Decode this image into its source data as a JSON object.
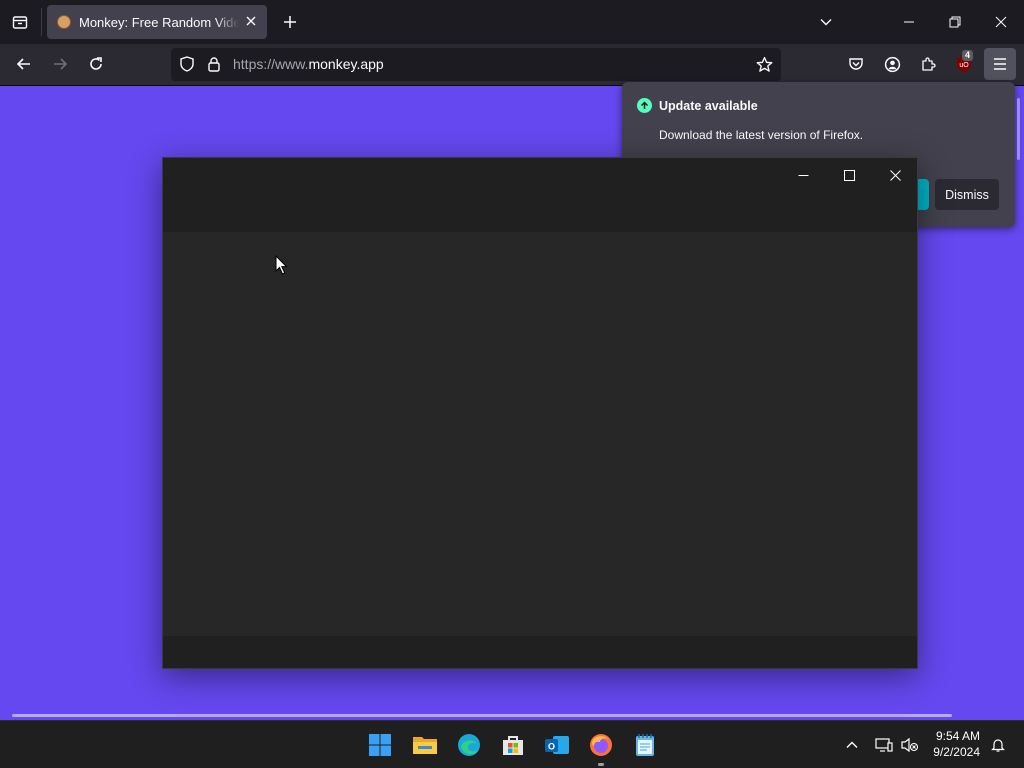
{
  "browser": {
    "tab_title": "Monkey: Free Random Video Chat",
    "url_prefix": "https://www.",
    "url_domain": "monkey.app",
    "extension_badge": "4",
    "icons": [
      "tab-list-icon",
      "close-icon",
      "new-tab-icon",
      "chevron-down-icon",
      "minimize-icon",
      "restore-icon",
      "back-icon",
      "forward-icon",
      "reload-icon",
      "shield-icon",
      "lock-icon",
      "star-icon",
      "pocket-icon",
      "account-icon",
      "extensions-icon",
      "ublock-icon",
      "menu-icon"
    ]
  },
  "update_panel": {
    "title": "Update available",
    "description": "Download the latest version of Firefox.",
    "dismiss_label": "Dismiss"
  },
  "taskbar": {
    "time": "9:54 AM",
    "date": "9/2/2024",
    "apps": [
      "start",
      "file-explorer",
      "edge",
      "store",
      "outlook",
      "firefox",
      "notepad"
    ]
  },
  "colors": {
    "page_bg": "#6548f0",
    "toolbar": "#2b2a33",
    "tabstrip": "#1c1b22",
    "dark_window": "#202020",
    "accent_update": "#54ffbd",
    "primary_button": "#00b3c9"
  }
}
